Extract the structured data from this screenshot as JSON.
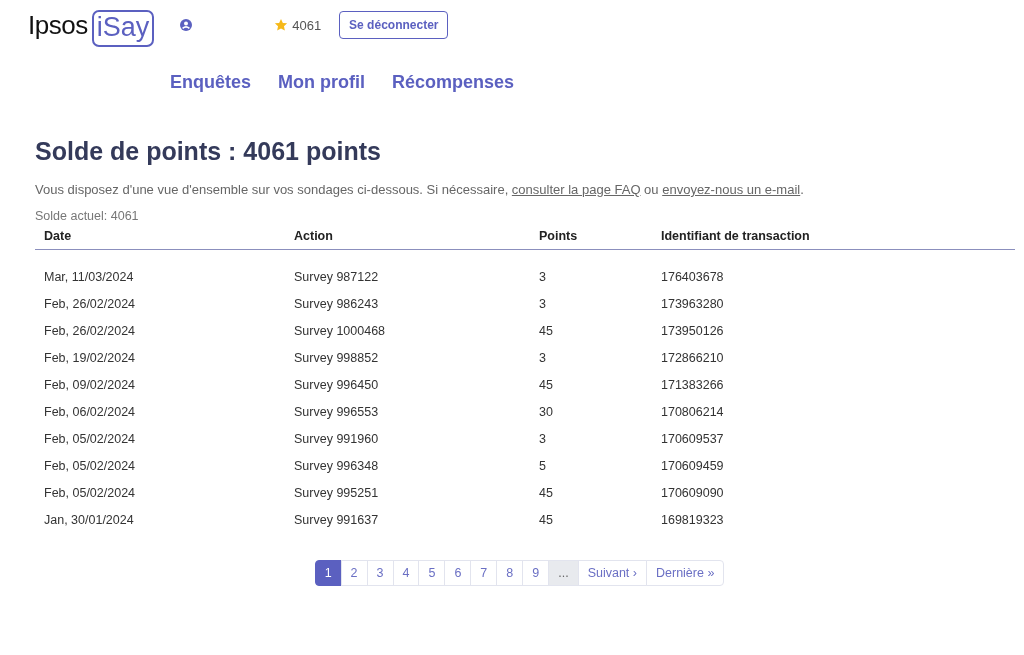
{
  "header": {
    "logo": {
      "brand": "Ipsos",
      "product": "iSay"
    },
    "points": "4061",
    "logout_button": "Se déconnecter"
  },
  "nav": [
    {
      "label": "Enquêtes"
    },
    {
      "label": "Mon profil"
    },
    {
      "label": "Récompenses"
    }
  ],
  "title": "Solde de points : 4061 points",
  "intro": {
    "text": "Vous disposez d'une vue d'ensemble sur vos sondages ci-dessous. Si nécessaire, ",
    "link1": "consulter la page FAQ",
    "middle": " ou ",
    "link2": "envoyez-nous un e-mail",
    "end": "."
  },
  "balance": "Solde actuel: 4061",
  "table": {
    "columns": [
      "Date",
      "Action",
      "Points",
      "Identifiant de transaction"
    ],
    "rows": [
      [
        "Mar, 11/03/2024",
        "Survey 987122",
        "3",
        "176403678"
      ],
      [
        "Feb, 26/02/2024",
        "Survey 986243",
        "3",
        "173963280"
      ],
      [
        "Feb, 26/02/2024",
        "Survey 1000468",
        "45",
        "173950126"
      ],
      [
        "Feb, 19/02/2024",
        "Survey 998852",
        "3",
        "172866210"
      ],
      [
        "Feb, 09/02/2024",
        "Survey 996450",
        "45",
        "171383266"
      ],
      [
        "Feb, 06/02/2024",
        "Survey 996553",
        "30",
        "170806214"
      ],
      [
        "Feb, 05/02/2024",
        "Survey 991960",
        "3",
        "170609537"
      ],
      [
        "Feb, 05/02/2024",
        "Survey 996348",
        "5",
        "170609459"
      ],
      [
        "Feb, 05/02/2024",
        "Survey 995251",
        "45",
        "170609090"
      ],
      [
        "Jan, 30/01/2024",
        "Survey 991637",
        "45",
        "169819323"
      ]
    ]
  },
  "pagination": [
    {
      "label": "1",
      "kind": "page",
      "selected": true
    },
    {
      "label": "2",
      "kind": "page",
      "selected": false
    },
    {
      "label": "3",
      "kind": "page",
      "selected": false
    },
    {
      "label": "4",
      "kind": "page",
      "selected": false
    },
    {
      "label": "5",
      "kind": "page",
      "selected": false
    },
    {
      "label": "6",
      "kind": "page",
      "selected": false
    },
    {
      "label": "7",
      "kind": "page",
      "selected": false
    },
    {
      "label": "8",
      "kind": "page",
      "selected": false
    },
    {
      "label": "9",
      "kind": "page",
      "selected": false
    },
    {
      "label": "...",
      "kind": "gap"
    },
    {
      "label": "Suivant ›",
      "kind": "nav",
      "selected": false
    },
    {
      "label": "Dernière »",
      "kind": "nav",
      "selected": false
    }
  ]
}
